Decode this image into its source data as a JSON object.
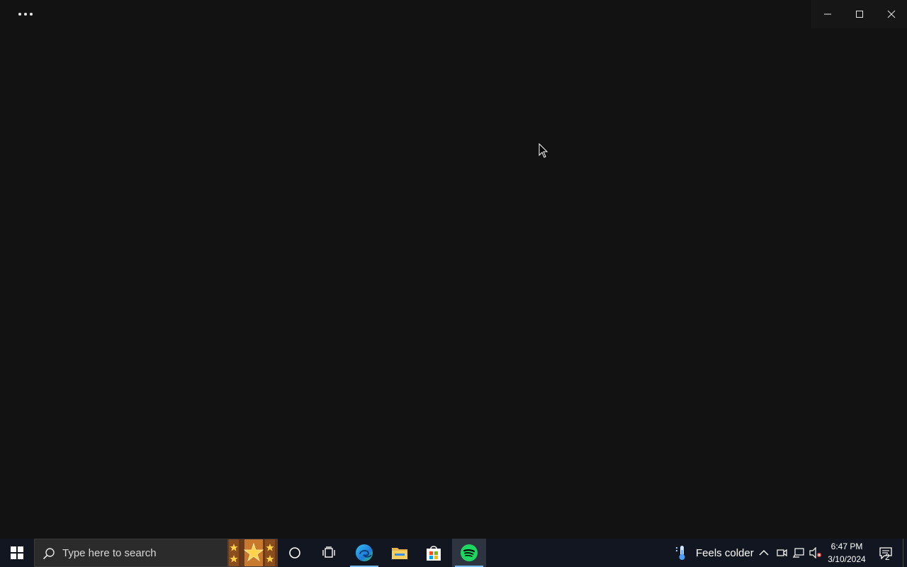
{
  "window": {
    "more_label": "More options",
    "caption": {
      "minimize": "minimize",
      "maximize": "maximize",
      "close": "close"
    }
  },
  "taskbar": {
    "search_placeholder": "Type here to search",
    "pinned": [
      "Cortana",
      "Task View",
      "Microsoft Edge",
      "File Explorer",
      "Microsoft Store",
      "Spotify"
    ],
    "weather": {
      "text": "Feels colder",
      "icon": "thermometer-icon"
    },
    "clock": {
      "time": "6:47 PM",
      "date": "3/10/2024"
    },
    "notification_count": "2"
  },
  "colors": {
    "background": "#121212",
    "taskbar": "#111620",
    "spotify_green": "#1ed760",
    "accent_underline": "#76b9ed"
  }
}
